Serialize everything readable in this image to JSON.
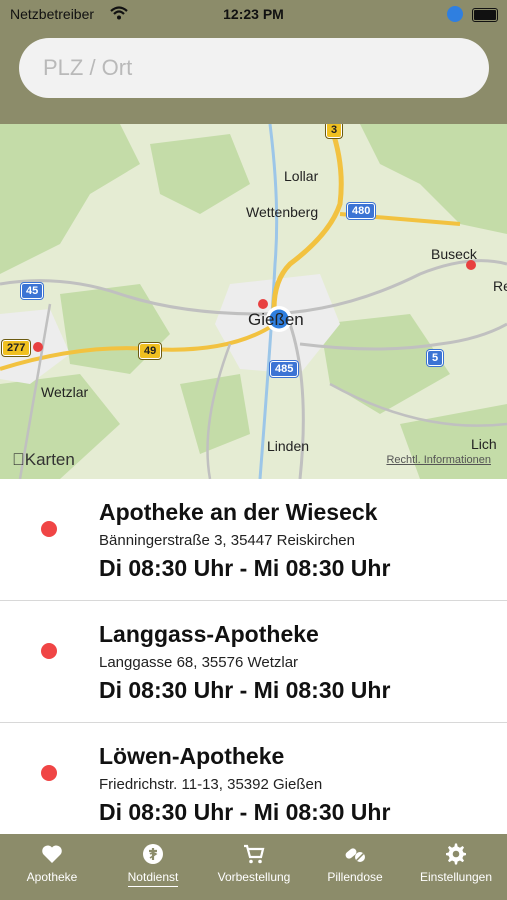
{
  "statusbar": {
    "carrier": "Netzbetreiber",
    "time": "12:23 PM"
  },
  "search": {
    "placeholder": "PLZ / Ort"
  },
  "map": {
    "places": {
      "lollar": "Lollar",
      "wettenberg": "Wettenberg",
      "buseck": "Buseck",
      "giessen": "Gießen",
      "wetzlar": "Wetzlar",
      "linden": "Linden",
      "lich": "Lich",
      "re": "Re"
    },
    "roads": {
      "a3": "3",
      "a480": "480",
      "a45": "45",
      "b49": "49",
      "b277": "277",
      "a485": "485",
      "a5": "5"
    },
    "attribution": "Karten",
    "legal": "Rechtl. Informationen"
  },
  "pharmacies": [
    {
      "name": "Apotheke an der Wieseck",
      "address": "Bänningerstraße 3, 35447 Reiskirchen",
      "hours": "Di 08:30 Uhr - Mi 08:30 Uhr"
    },
    {
      "name": "Langgass-Apotheke",
      "address": "Langgasse 68, 35576 Wetzlar",
      "hours": "Di 08:30 Uhr - Mi 08:30 Uhr"
    },
    {
      "name": "Löwen-Apotheke",
      "address": "Friedrichstr. 11-13, 35392 Gießen",
      "hours": "Di 08:30 Uhr - Mi 08:30 Uhr"
    }
  ],
  "tabs": [
    {
      "label": "Apotheke",
      "icon": "heart-icon"
    },
    {
      "label": "Notdienst",
      "icon": "emergency-icon",
      "active": true
    },
    {
      "label": "Vorbestellung",
      "icon": "cart-icon"
    },
    {
      "label": "Pillendose",
      "icon": "pills-icon"
    },
    {
      "label": "Einstellungen",
      "icon": "gear-icon"
    }
  ],
  "colors": {
    "header": "#8c8c6a",
    "dot": "#f04545",
    "location": "#2f7fe0"
  }
}
